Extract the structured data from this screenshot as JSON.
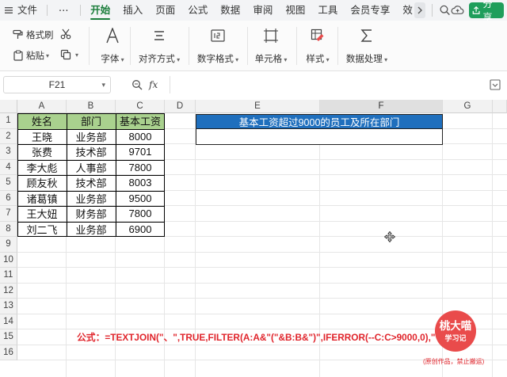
{
  "menubar": {
    "items": [
      "文件",
      "⋯",
      "开始",
      "插入",
      "页面",
      "公式",
      "数据",
      "审阅",
      "视图",
      "工具",
      "会员专享",
      "效"
    ],
    "active_index": 2,
    "share_label": "分享",
    "accent": "#1b7d3b",
    "share_color": "#1f9e5b"
  },
  "ribbon": {
    "format_painter": "格式刷",
    "paste": "粘贴",
    "font": "字体",
    "alignment": "对齐方式",
    "number_format": "数字格式",
    "cell": "单元格",
    "style": "样式",
    "data_processing": "数据处理"
  },
  "formula_bar": {
    "cell_ref": "F21",
    "fx_label": "fx",
    "value": ""
  },
  "sheet": {
    "columns": [
      "A",
      "B",
      "C",
      "D",
      "E",
      "F",
      "G"
    ],
    "selected_column": "F",
    "rows": [
      "1",
      "2",
      "3",
      "4",
      "5",
      "6",
      "7",
      "8",
      "9",
      "10",
      "11",
      "12",
      "13",
      "14",
      "15",
      "16"
    ],
    "table": {
      "headers": [
        "姓名",
        "部门",
        "基本工资"
      ],
      "header_color": "#a9d18e",
      "rows": [
        [
          "王晓",
          "业务部",
          "8000"
        ],
        [
          "张费",
          "技术部",
          "9701"
        ],
        [
          "李大彪",
          "人事部",
          "7800"
        ],
        [
          "顾友秋",
          "技术部",
          "8003"
        ],
        [
          "诸葛镇",
          "业务部",
          "9500"
        ],
        [
          "王大妞",
          "财务部",
          "7800"
        ],
        [
          "刘二飞",
          "业务部",
          "6900"
        ]
      ]
    },
    "result_title": "基本工资超过9000的员工及所在部门",
    "result_title_color": "#1f6fbd",
    "formula_note": "公式：=TEXTJOIN(\"、\",TRUE,FILTER(A:A&\"(\"&B:B&\")\",IFERROR(--C:C>9000,0),\"\"))",
    "formula_color": "#e0242b"
  },
  "watermark": {
    "name": "桃大喵",
    "sub": "学习记",
    "note": "(原创作品，禁止搬运)",
    "color": "#e94b4b"
  }
}
